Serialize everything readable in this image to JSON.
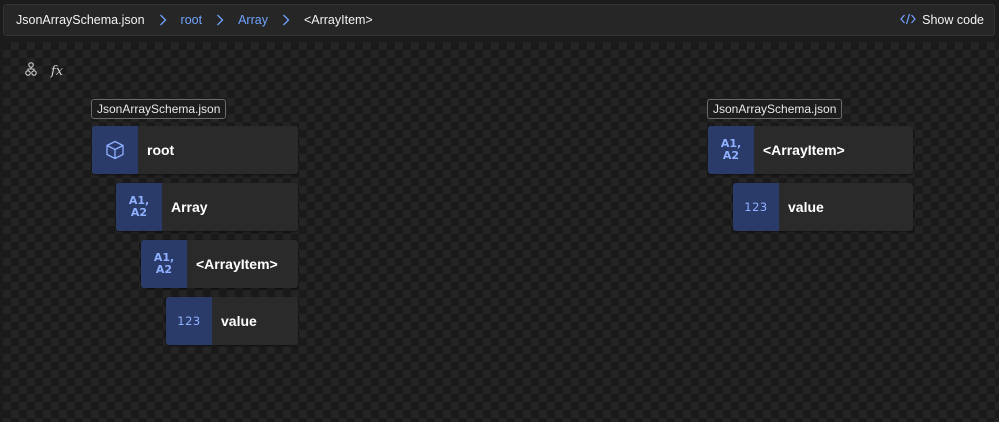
{
  "breadcrumb": {
    "file": "JsonArraySchema.json",
    "items": [
      "root",
      "Array",
      "<ArrayItem>"
    ]
  },
  "toolbar": {
    "show_code_label": "Show code",
    "function_label": "fx"
  },
  "source_schema": {
    "tag": "JsonArraySchema.json",
    "nodes": [
      {
        "label": "root",
        "icon": "cube-icon"
      },
      {
        "label": "Array",
        "icon": "array-icon",
        "icon_text": [
          "A1,",
          "A2"
        ]
      },
      {
        "label": "<ArrayItem>",
        "icon": "array-icon",
        "icon_text": [
          "A1,",
          "A2"
        ]
      },
      {
        "label": "value",
        "icon": "number-icon",
        "icon_text": "123"
      }
    ]
  },
  "target_schema": {
    "tag": "JsonArraySchema.json",
    "nodes": [
      {
        "label": "<ArrayItem>",
        "icon": "array-icon",
        "icon_text": [
          "A1,",
          "A2"
        ]
      },
      {
        "label": "value",
        "icon": "number-icon",
        "icon_text": "123"
      }
    ]
  },
  "colors": {
    "link": "#6fa3ff",
    "node_icon_bg": "#2a3b6a",
    "node_bg": "#2a2a2a",
    "icon_fg": "#8fb0ff"
  }
}
